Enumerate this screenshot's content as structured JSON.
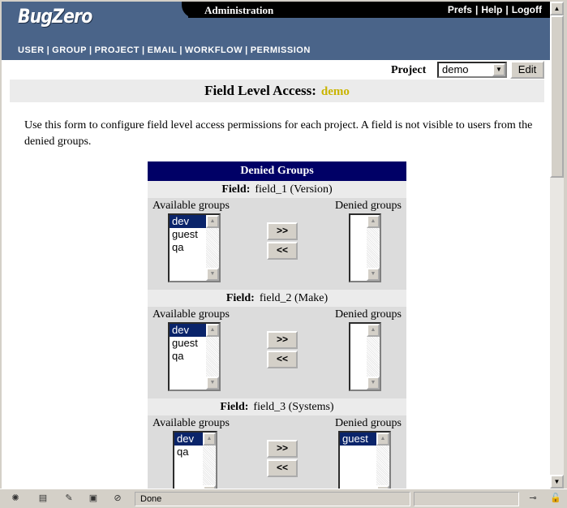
{
  "header": {
    "logo": "BugZero",
    "section_title": "Administration",
    "top_links": [
      "Prefs",
      "Help",
      "Logoff"
    ],
    "nav": [
      "USER",
      "GROUP",
      "PROJECT",
      "EMAIL",
      "WORKFLOW",
      "PERMISSION"
    ]
  },
  "project_bar": {
    "label": "Project",
    "selected": "demo",
    "edit_label": "Edit"
  },
  "page": {
    "title": "Field Level Access:",
    "project_name": "demo",
    "description": "Use this form to configure field level access permissions for each project. A field is not visible to users from the denied groups."
  },
  "denied_groups": {
    "heading": "Denied Groups",
    "field_label": "Field:",
    "available_label": "Available groups",
    "denied_label": "Denied groups",
    "add_label": ">>",
    "remove_label": "<<",
    "fields": [
      {
        "name": "field_1 (Version)",
        "available": [
          "dev",
          "guest",
          "qa"
        ],
        "selected_available": "dev",
        "denied": []
      },
      {
        "name": "field_2 (Make)",
        "available": [
          "dev",
          "guest",
          "qa"
        ],
        "selected_available": "dev",
        "denied": []
      },
      {
        "name": "field_3 (Systems)",
        "available": [
          "dev",
          "qa"
        ],
        "selected_available": "dev",
        "denied": [
          "guest"
        ]
      }
    ]
  },
  "status_bar": {
    "text": "Done"
  }
}
